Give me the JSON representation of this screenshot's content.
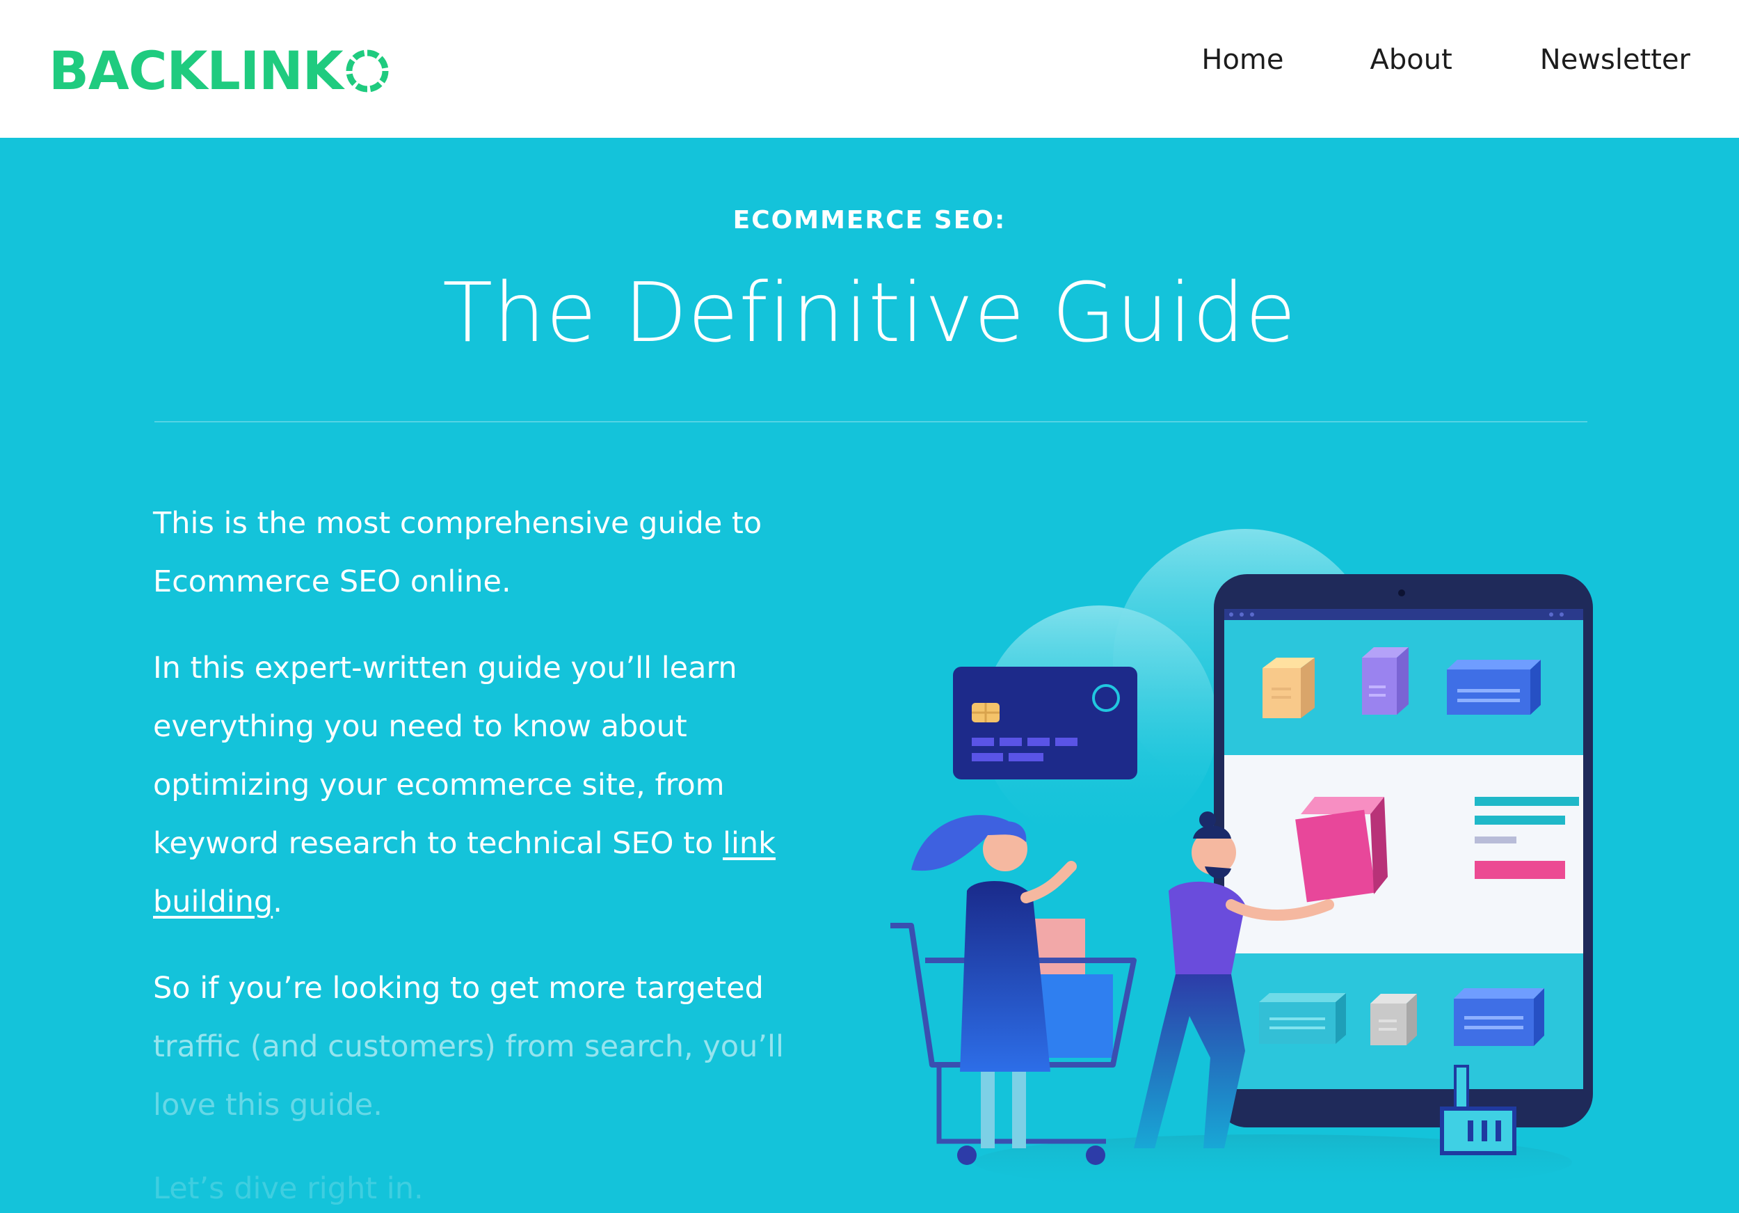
{
  "header": {
    "logo_text": "BACKLINK",
    "nav": [
      {
        "label": "Home"
      },
      {
        "label": "About"
      },
      {
        "label": "Newsletter"
      }
    ]
  },
  "hero": {
    "eyebrow": "ECOMMERCE SEO:",
    "title": "The Definitive Guide"
  },
  "content": {
    "p1": "This is the most comprehensive guide to Ecommerce SEO online.",
    "p2_before_link": "In this expert-written guide you’ll learn everything you need to know about optimizing your ecommerce site, from keyword research to technical SEO to ",
    "p2_link": "link building",
    "p2_after_link": ".",
    "p3_line1": "So if you’re looking to get more targeted",
    "p3_line2": "traffic (and customers) from search, you’ll",
    "p3_line3": "love this guide.",
    "p4": "Let’s dive right in."
  },
  "colors": {
    "brand_green": "#1fcb7f",
    "hero_bg": "#14c3da",
    "text_dark": "#1c1c1c"
  },
  "illustration": {
    "icons": [
      "cloud-icon",
      "credit-card-icon",
      "tablet-icon",
      "shopping-cart-icon",
      "pointer-hand-icon"
    ]
  }
}
